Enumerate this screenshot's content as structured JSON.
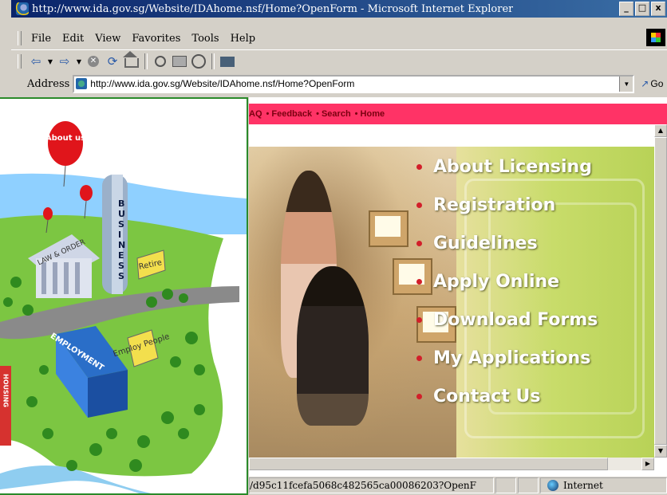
{
  "window": {
    "title": "http://www.ida.gov.sg/Website/IDAhome.nsf/Home?OpenForm - Microsoft Internet Explorer",
    "controls": [
      "_",
      "□",
      "x"
    ]
  },
  "menubar": [
    "File",
    "Edit",
    "View",
    "Favorites",
    "Tools",
    "Help"
  ],
  "toolbar": {
    "icons": [
      "back-icon",
      "forward-icon",
      "stop-icon",
      "refresh-icon",
      "home-icon",
      "search-icon",
      "favorites-icon",
      "history-icon",
      "mail-icon"
    ]
  },
  "address": {
    "label": "Address",
    "url": "http://www.ida.gov.sg/Website/IDAhome.nsf/Home?OpenForm",
    "go": "Go"
  },
  "page": {
    "nav_links": [
      "AQ",
      "Feedback",
      "Search",
      "Home"
    ],
    "menu": [
      "About Licensing",
      "Registration",
      "Guidelines",
      "Apply Online",
      "Download Forms",
      "My Applications",
      "Contact Us"
    ],
    "colors": {
      "nav_bg": "#ff3366",
      "menu_bullet": "#d21f2a",
      "hero_green": "#b8d257"
    }
  },
  "statusbar": {
    "text": "/d95c11fcefa5068c482565ca00086203?OpenF",
    "zone": "Internet"
  },
  "city": {
    "balloon": "About us",
    "buildings": {
      "law": "LAW & ORDER",
      "business": "BUSINESS",
      "employment": "EMPLOYMENT",
      "housing": "HOUSING"
    },
    "signs": {
      "retire": "Retire",
      "employ": "Employ People"
    }
  }
}
